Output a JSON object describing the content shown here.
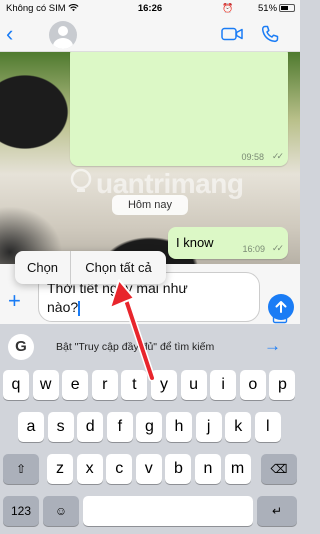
{
  "status": {
    "carrier": "Không có SIM",
    "time": "16:26",
    "battery": "51%"
  },
  "header": {
    "back": "‹"
  },
  "chat": {
    "msg1_time": "09:58",
    "date_chip": "Hôm nay",
    "msg2_text": "I know",
    "msg2_time": "16:09",
    "ticks": "✓✓"
  },
  "watermark": "uantrimang",
  "composer": {
    "text_line1": "Thời tiết ngày mai như",
    "text_line2": "nào?"
  },
  "context_menu": {
    "select": "Chọn",
    "select_all": "Chọn tất cả"
  },
  "suggestion": {
    "g": "G",
    "text": "Bật \"Truy cập đầy đủ\" để tìm kiếm",
    "arrow": "→"
  },
  "keyboard": {
    "row1": [
      "q",
      "w",
      "e",
      "r",
      "t",
      "y",
      "u",
      "i",
      "o",
      "p"
    ],
    "row2": [
      "a",
      "s",
      "d",
      "f",
      "g",
      "h",
      "j",
      "k",
      "l"
    ],
    "row3": [
      "z",
      "x",
      "c",
      "v",
      "b",
      "n",
      "m"
    ],
    "shift": "⇧",
    "delete": "⌫",
    "numbers": "123",
    "emoji": "☺",
    "mic": "🎤",
    "space": "space",
    "return": "↵"
  },
  "colors": {
    "accent": "#1a7cf5",
    "bubble_out": "#dcf8c6",
    "arrow": "#e8252c"
  }
}
